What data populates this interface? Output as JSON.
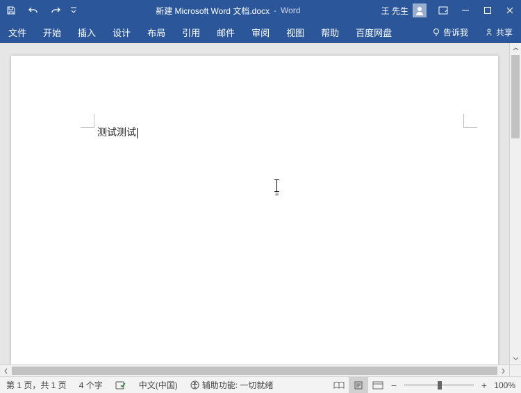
{
  "titlebar": {
    "docname": "新建 Microsoft Word 文档.docx",
    "separator": "-",
    "appname": "Word",
    "account_name": "王 先生"
  },
  "ribbon": {
    "tabs": [
      "文件",
      "开始",
      "插入",
      "设计",
      "布局",
      "引用",
      "邮件",
      "审阅",
      "视图",
      "帮助",
      "百度网盘"
    ],
    "tell_me": "告诉我",
    "share": "共享"
  },
  "document": {
    "body_text": "测试测试"
  },
  "statusbar": {
    "page_info": "第 1 页，共 1 页",
    "word_count": "4 个字",
    "language": "中文(中国)",
    "accessibility": "辅助功能: 一切就绪",
    "zoom_percent": "100%"
  },
  "icons": {
    "minus": "−",
    "plus": "+"
  }
}
